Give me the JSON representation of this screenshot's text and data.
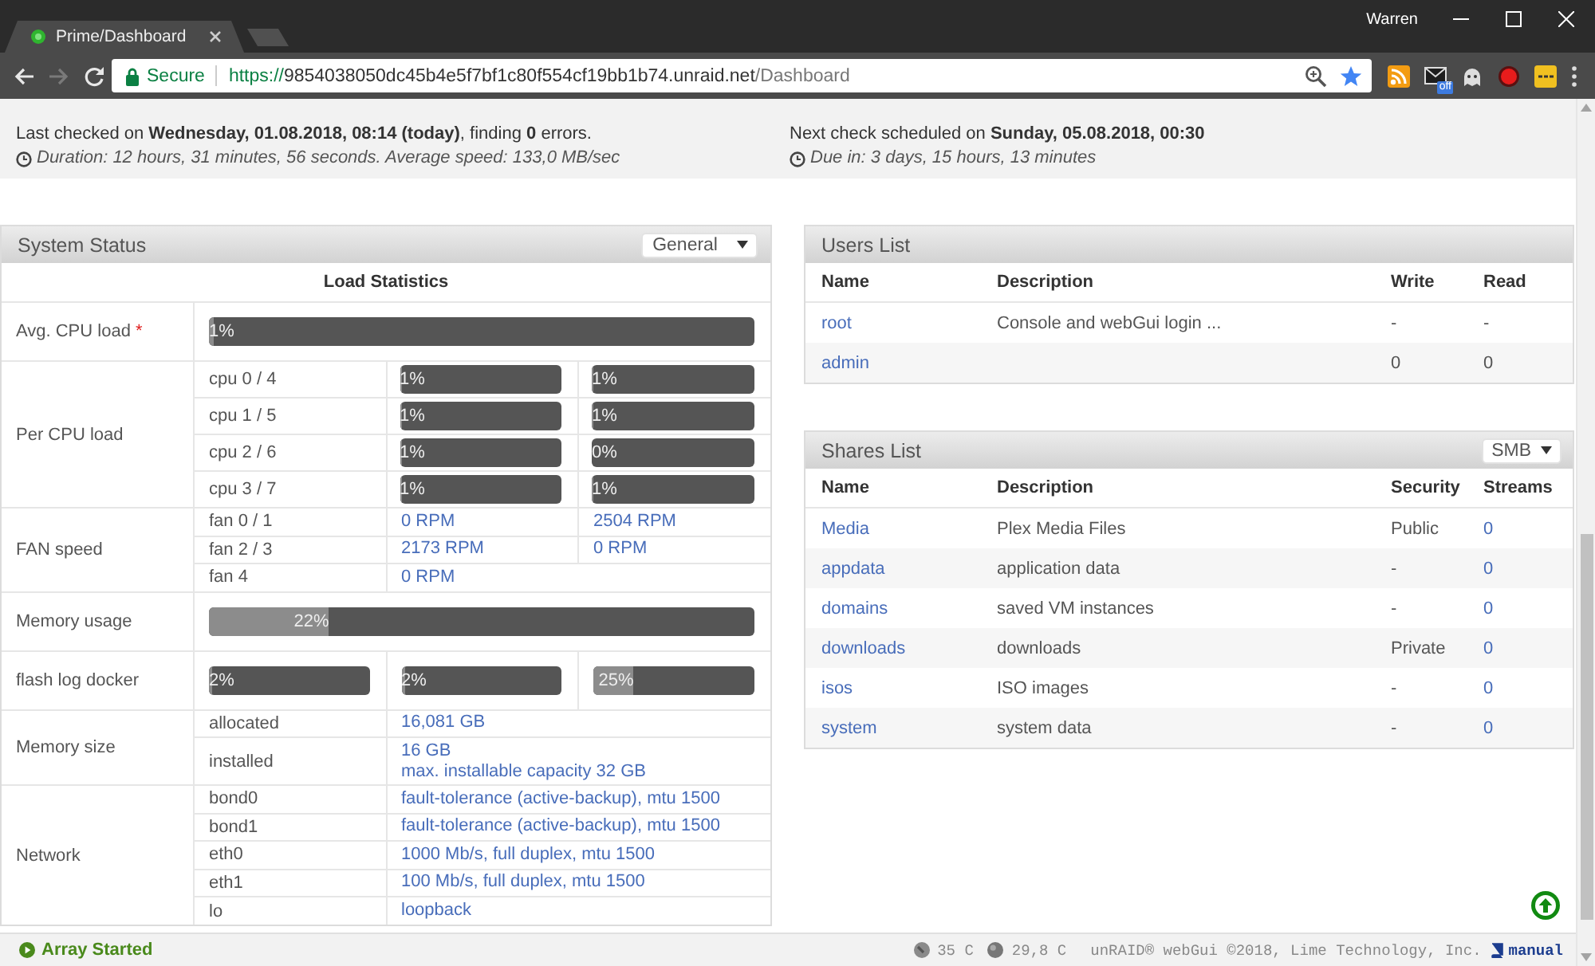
{
  "browser": {
    "tabs": [
      {
        "title": "Prime/Dashboard",
        "selected": true
      }
    ],
    "user": "Warren",
    "security": "Secure",
    "url": {
      "scheme": "https://",
      "host": "9854038050dc45b4e5f7bf1c80f554cf19bb1b74.unraid.net",
      "path": "/Dashboard"
    },
    "extension_badge": "off"
  },
  "parity": {
    "last_check": "Last checked on **Wednesday, 01.08.2018, 08:14 (today)**, finding **0** errors.",
    "duration": "Duration: 12 hours, 31 minutes, 56 seconds. Average speed: 133,0 MB/sec",
    "next_check": "Next check scheduled on **Sunday, 05.08.2018, 00:30**",
    "due": "Due in: 3 days, 15 hours, 13 minutes"
  },
  "system_status": {
    "title": "System Status",
    "view": "General",
    "heading": "Load Statistics",
    "groups": [
      {
        "kind": "bar",
        "label": "Avg. CPU load",
        "note": "*",
        "bar": {
          "text": "1%",
          "level": 0.01
        }
      },
      {
        "kind": "rows",
        "label": "Per CPU load",
        "rows": [
          {
            "name": "cpu 0 / 4",
            "cells": [
              {
                "kind": "bar",
                "text": "1%",
                "level": 0.01
              },
              {
                "kind": "bar",
                "text": "1%",
                "level": 0.01
              }
            ]
          },
          {
            "name": "cpu 1 / 5",
            "cells": [
              {
                "kind": "bar",
                "text": "1%",
                "level": 0.01
              },
              {
                "kind": "bar",
                "text": "1%",
                "level": 0.01
              }
            ]
          },
          {
            "name": "cpu 2 / 6",
            "cells": [
              {
                "kind": "bar",
                "text": "1%",
                "level": 0.01
              },
              {
                "kind": "bar",
                "text": "0%",
                "level": 0
              }
            ]
          },
          {
            "name": "cpu 3 / 7",
            "cells": [
              {
                "kind": "bar",
                "text": "1%",
                "level": 0.01
              },
              {
                "kind": "bar",
                "text": "1%",
                "level": 0.01
              }
            ]
          }
        ]
      },
      {
        "kind": "rows",
        "label": "FAN speed",
        "rows": [
          {
            "name": "fan 0 / 1",
            "cells": [
              {
                "kind": "text",
                "text": "0 RPM"
              },
              {
                "kind": "text",
                "text": "2504 RPM"
              }
            ]
          },
          {
            "name": "fan 2 / 3",
            "cells": [
              {
                "kind": "text",
                "text": "2173 RPM"
              },
              {
                "kind": "text",
                "text": "0 RPM"
              }
            ]
          },
          {
            "name": "fan 4",
            "cells": [
              {
                "kind": "text",
                "text": "0 RPM"
              }
            ]
          }
        ]
      },
      {
        "kind": "bar",
        "label": "Memory usage",
        "bar": {
          "text": "22%",
          "level": 0.22
        }
      },
      {
        "kind": "bars",
        "label": "flash log docker",
        "bars": [
          {
            "text": "2%",
            "level": 0.02
          },
          {
            "text": "2%",
            "level": 0.02
          },
          {
            "text": "25%",
            "level": 0.25
          }
        ]
      },
      {
        "kind": "rows",
        "label": "Memory size",
        "rows": [
          {
            "name": "allocated",
            "cells": [
              {
                "kind": "text",
                "text": "16,081 GB"
              }
            ]
          },
          {
            "name": "installed",
            "cells": [
              {
                "kind": "lines",
                "lines": [
                  "16 GB",
                  "max. installable capacity 32 GB"
                ]
              }
            ]
          }
        ]
      },
      {
        "kind": "rows",
        "label": "Network",
        "rows": [
          {
            "name": "bond0",
            "cells": [
              {
                "kind": "text",
                "text": "fault-tolerance (active-backup), mtu 1500"
              }
            ]
          },
          {
            "name": "bond1",
            "cells": [
              {
                "kind": "text",
                "text": "fault-tolerance (active-backup), mtu 1500"
              }
            ]
          },
          {
            "name": "eth0",
            "cells": [
              {
                "kind": "text",
                "text": "1000 Mb/s, full duplex, mtu 1500"
              }
            ]
          },
          {
            "name": "eth1",
            "cells": [
              {
                "kind": "text",
                "text": "100 Mb/s, full duplex, mtu 1500"
              }
            ]
          },
          {
            "name": "lo",
            "cells": [
              {
                "kind": "text",
                "text": "loopback"
              }
            ]
          }
        ]
      }
    ]
  },
  "users": {
    "title": "Users List",
    "columns": [
      "Name",
      "Description",
      "Write",
      "Read"
    ],
    "rows": [
      {
        "name": "root",
        "description": "Console and webGui login ...",
        "write": "-",
        "read": "-"
      },
      {
        "name": "admin",
        "write": "0",
        "read": "0"
      }
    ]
  },
  "shares": {
    "title": "Shares List",
    "protocol": "SMB",
    "columns": [
      "Name",
      "Description",
      "Security",
      "Streams"
    ],
    "rows": [
      {
        "name": "Media",
        "description": "Plex Media Files",
        "security": "Public",
        "streams": "0"
      },
      {
        "name": "appdata",
        "description": "application data",
        "security": "-",
        "streams": "0"
      },
      {
        "name": "domains",
        "description": "saved VM instances",
        "security": "-",
        "streams": "0"
      },
      {
        "name": "downloads",
        "description": "downloads",
        "security": "Private",
        "streams": "0"
      },
      {
        "name": "isos",
        "description": "ISO images",
        "security": "-",
        "streams": "0"
      },
      {
        "name": "system",
        "description": "system data",
        "security": "-",
        "streams": "0"
      }
    ]
  },
  "status_bar": {
    "array_state": "Array Started",
    "temps": [
      {
        "kind": "disk",
        "text": "35 C"
      },
      {
        "kind": "cpu",
        "text": "29,8 C"
      }
    ],
    "copyright": "unRAID® webGui ©2018, Lime Technology, Inc.",
    "manual": "manual"
  }
}
